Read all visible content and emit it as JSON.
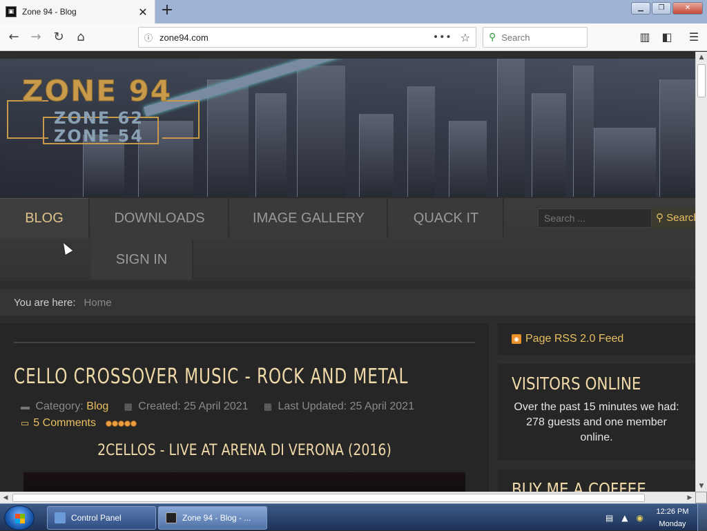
{
  "browser": {
    "tab_title": "Zone 94 - Blog",
    "tab_close": "✕",
    "new_tab": "+",
    "url": "zone94.com",
    "url_info_icon": "ⓘ",
    "page_actions": "•••",
    "bookmark_star": "☆",
    "search_placeholder": "Search"
  },
  "site": {
    "logo": {
      "main": "ZONE 94",
      "sub1": "ZONE 62",
      "sub2": "ZONE 54"
    },
    "menu": {
      "items": [
        "BLOG",
        "DOWNLOADS",
        "IMAGE GALLERY",
        "QUACK IT",
        "SIGN IN"
      ],
      "active": "BLOG"
    },
    "search_placeholder": "Search ...",
    "search_button": "Search",
    "breadcrumb": {
      "label": "You are here:",
      "home": "Home"
    }
  },
  "article": {
    "title": "CELLO CROSSOVER MUSIC - ROCK AND METAL",
    "category_label": "Category:",
    "category": "Blog",
    "created": "Created: 25 April 2021",
    "updated": "Last Updated: 25 April 2021",
    "comments": "5 Comments",
    "rating": 5,
    "video_title": "2CELLOS - LIVE AT ARENA DI VERONA (2016)"
  },
  "sidebar": {
    "rss": "Page RSS 2.0 Feed",
    "visitors_title": "VISITORS ONLINE",
    "visitors_text": "Over the past 15 minutes we had: 278 guests and one member online.",
    "coffee_title": "BUY ME A COFFEE"
  },
  "taskbar": {
    "items": [
      "Control Panel",
      "Zone 94 - Blog - ..."
    ],
    "time": "12:26 PM",
    "day": "Monday"
  },
  "colors": {
    "accent_gold": "#e8c060",
    "heading_cream": "#f0d9a8",
    "page_bg": "#2d2d2d"
  }
}
